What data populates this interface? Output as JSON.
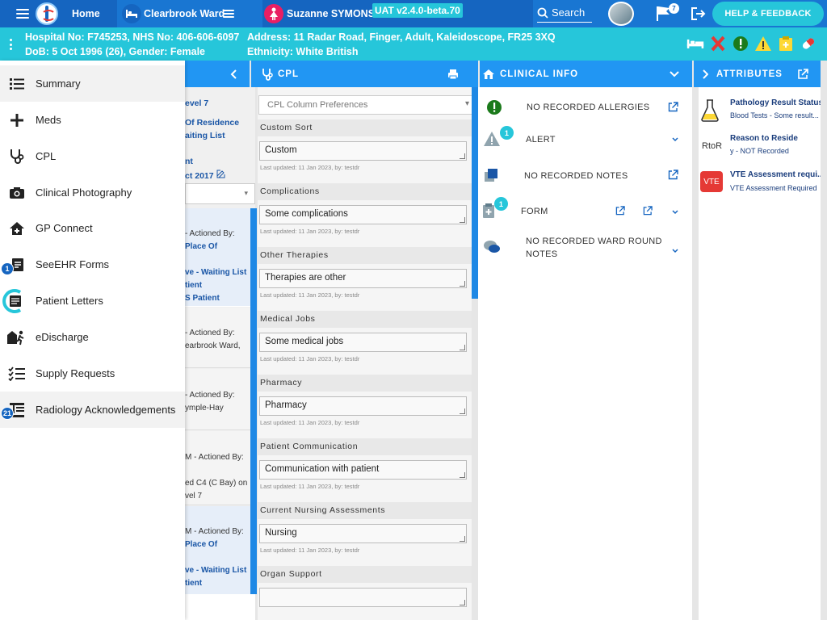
{
  "topbar": {
    "home_label": "Home",
    "ward_label": "Clearbrook Ward",
    "patient_name": "Suzanne SYMONS",
    "version": "UAT v2.4.0-beta.70",
    "search_label": "Search",
    "flag_count": "7",
    "help_label": "HELP & FEEDBACK"
  },
  "patient": {
    "hospital_line": "Hospital No: F745253, NHS No: 406-606-6097",
    "dob_line": "DoB: 5 Oct 1996 (26), Gender: Female",
    "address_line": "Address: 11 Radar Road, Finger, Adult, Kaleidoscope, FR25 3XQ",
    "ethnicity_line": "Ethnicity: White British",
    "status_icons": [
      "bed-icon",
      "no-resus-icon",
      "alert-circle-icon",
      "warning-icon",
      "clipboard-icon",
      "medication-icon"
    ]
  },
  "sidebar": {
    "items": [
      {
        "label": "Summary",
        "icon": "list-icon",
        "badge": ""
      },
      {
        "label": "Meds",
        "icon": "plus-icon",
        "badge": ""
      },
      {
        "label": "CPL",
        "icon": "stethoscope-icon",
        "badge": ""
      },
      {
        "label": "Clinical Photography",
        "icon": "camera-icon",
        "badge": ""
      },
      {
        "label": "GP Connect",
        "icon": "gp-house-icon",
        "badge": ""
      },
      {
        "label": "SeeEHR Forms",
        "icon": "form-icon",
        "badge": "1"
      },
      {
        "label": "Patient Letters",
        "icon": "letter-icon",
        "badge": ""
      },
      {
        "label": "eDischarge",
        "icon": "discharge-icon",
        "badge": ""
      },
      {
        "label": "Supply Requests",
        "icon": "checklist-icon",
        "badge": ""
      },
      {
        "label": "Radiology Acknowledgements",
        "icon": "radiology-icon",
        "badge": "21"
      }
    ]
  },
  "partial_col": {
    "level": "evel 7",
    "residence_1": "Of Residence",
    "residence_2": "aiting List",
    "ent": "nt",
    "date": "ct 2017",
    "entries": [
      {
        "l1": "- Actioned By:",
        "l2": "Place Of",
        "l3": "ve - Waiting List",
        "l4": "tient",
        "l5": "S Patient"
      },
      {
        "l1": "- Actioned By:",
        "l2": "earbrook Ward,"
      },
      {
        "l1": "- Actioned By:",
        "l2": "ymple-Hay"
      },
      {
        "l1": "M - Actioned By:",
        "l2": "ed C4 (C Bay) on",
        "l3": "vel 7"
      },
      {
        "l1": "M - Actioned By:",
        "l2": "Place Of",
        "l3": "ve - Waiting List",
        "l4": "tient"
      }
    ]
  },
  "cpl": {
    "header": "CPL",
    "pref_placeholder": "CPL Column Preferences",
    "sections": [
      {
        "title": "Custom Sort",
        "value": "Custom",
        "meta": "Last updated: 11 Jan 2023, by: testdr"
      },
      {
        "title": "Complications",
        "value": "Some complications",
        "meta": "Last updated: 11 Jan 2023, by: testdr"
      },
      {
        "title": "Other Therapies",
        "value": "Therapies are other",
        "meta": "Last updated: 11 Jan 2023, by: testdr"
      },
      {
        "title": "Medical Jobs",
        "value": "Some medical jobs",
        "meta": "Last updated: 11 Jan 2023, by: testdr"
      },
      {
        "title": "Pharmacy",
        "value": "Pharmacy",
        "meta": "Last updated: 11 Jan 2023, by: testdr"
      },
      {
        "title": "Patient Communication",
        "value": "Communication with patient",
        "meta": "Last updated: 11 Jan 2023, by: testdr"
      },
      {
        "title": "Current Nursing Assessments",
        "value": "Nursing",
        "meta": "Last updated: 11 Jan 2023, by: testdr"
      },
      {
        "title": "Organ Support",
        "value": "",
        "meta": ""
      }
    ]
  },
  "clinical": {
    "header": "CLINICAL INFO",
    "allergies": "NO RECORDED ALLERGIES",
    "alert": "ALERT",
    "alert_count": "1",
    "notes": "NO RECORDED NOTES",
    "form": "FORM",
    "form_count": "1",
    "ward_round_1": "NO RECORDED WARD ROUND",
    "ward_round_2": "NOTES"
  },
  "attributes": {
    "header": "ATTRIBUTES",
    "items": [
      {
        "title": "Pathology Result Status",
        "sub": "Blood Tests - Some result..."
      },
      {
        "title": "Reason to Reside",
        "sub": "y - NOT Recorded",
        "tag": "RtoR"
      },
      {
        "title": "VTE Assessment requi...",
        "sub": "VTE Assessment Required",
        "tag": "VTE"
      }
    ]
  }
}
